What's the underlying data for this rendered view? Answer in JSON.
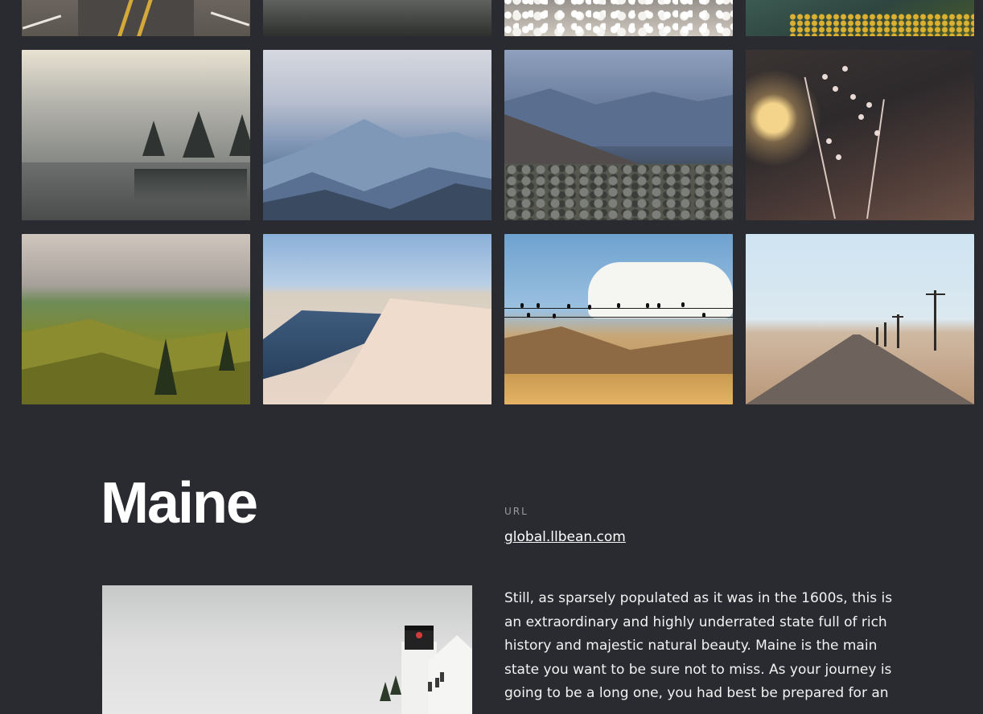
{
  "gallery": {
    "row1": [
      {
        "name": "road-image-top"
      },
      {
        "name": "mist-image-top"
      },
      {
        "name": "cotton-field-image-top"
      },
      {
        "name": "yellow-flowers-image-top"
      }
    ],
    "row2": [
      {
        "name": "foggy-lake-image"
      },
      {
        "name": "blue-mountains-image"
      },
      {
        "name": "rocky-ridge-image"
      },
      {
        "name": "dried-flower-image"
      }
    ],
    "row3": [
      {
        "name": "green-valley-image"
      },
      {
        "name": "sand-dunes-lake-image"
      },
      {
        "name": "birds-on-wire-image"
      },
      {
        "name": "desert-road-image"
      }
    ]
  },
  "section": {
    "title": "Maine",
    "url_label": "URL",
    "url_text": "global.llbean.com",
    "description": "Still, as sparsely populated as it was in the 1600s, this is an extraordinary and highly underrated state full of rich history and majestic natural beauty. Maine is the main state you want to be sure not to miss. As your journey is going to be a long one, you had best be prepared for an",
    "feature_image": "lighthouse-image"
  },
  "colors": {
    "background": "#2a2b30",
    "text": "#ffffff",
    "muted_label": "#9a9ba0"
  }
}
